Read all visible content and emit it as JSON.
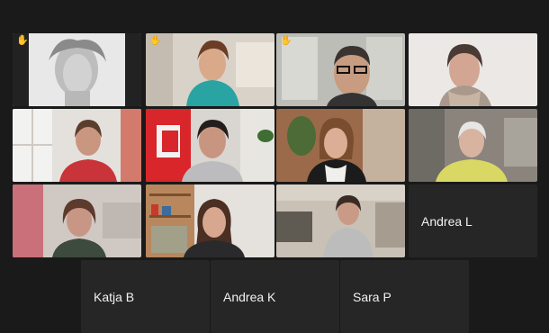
{
  "participants": [
    {
      "name": "",
      "video": true,
      "hand_raised": true,
      "active_speaker": true
    },
    {
      "name": "",
      "video": true,
      "hand_raised": true
    },
    {
      "name": "",
      "video": true,
      "hand_raised": true
    },
    {
      "name": "",
      "video": true
    },
    {
      "name": "",
      "video": true
    },
    {
      "name": "",
      "video": true
    },
    {
      "name": "",
      "video": true
    },
    {
      "name": "",
      "video": true
    },
    {
      "name": "",
      "video": true
    },
    {
      "name": "",
      "video": true
    },
    {
      "name": "",
      "video": true
    },
    {
      "name": "Andrea L",
      "video": false
    },
    {
      "name": "Katja B",
      "video": false
    },
    {
      "name": "Andrea K",
      "video": false
    },
    {
      "name": "Sara P",
      "video": false
    }
  ],
  "icons": {
    "raised_hand": "raised-hand-icon"
  },
  "colors": {
    "background": "#1a1a1a",
    "tile": "#262626",
    "active_border": "#c7d53a",
    "hand": "#f2b01e",
    "name_text": "#f1f1f1"
  }
}
